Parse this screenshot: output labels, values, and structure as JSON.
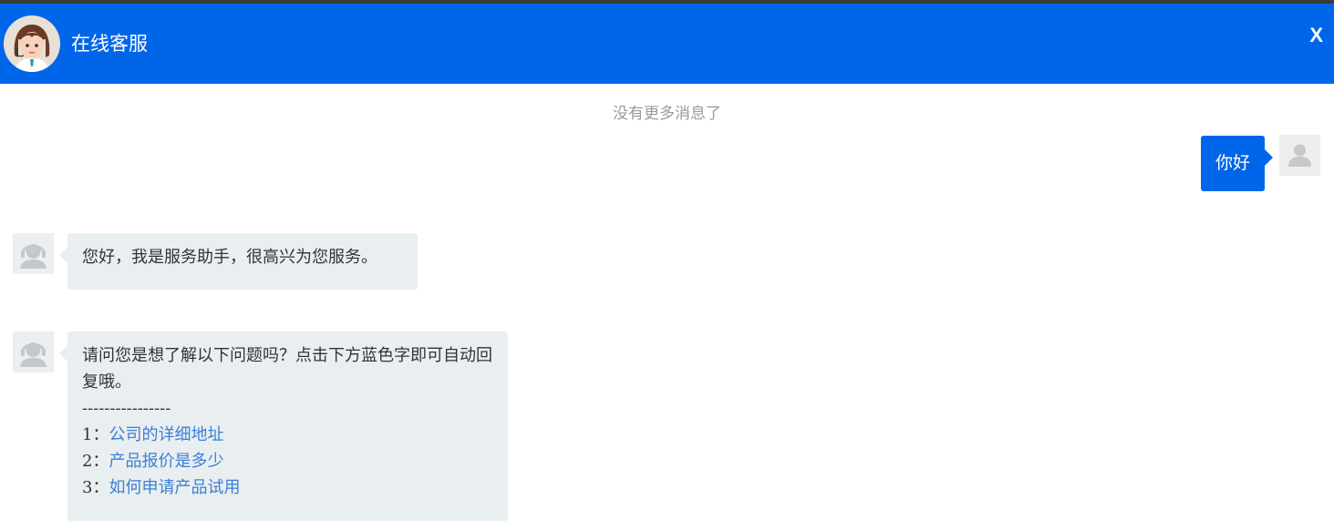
{
  "header": {
    "title": "在线客服",
    "close_label": "X",
    "bg_color": "#0066e9"
  },
  "chat": {
    "no_more_messages": "没有更多消息了",
    "user_message": "你好",
    "bot_greeting": "您好，我是服务助手，很高兴为您服务。",
    "bot_prompt": "请问您是想了解以下问题吗？点击下方蓝色字即可自动回复哦。",
    "divider": "----------------",
    "options": [
      {
        "num": "1：",
        "text": "公司的详细地址"
      },
      {
        "num": "2：",
        "text": "产品报价是多少"
      },
      {
        "num": "3：",
        "text": "如何申请产品试用"
      }
    ],
    "link_color": "#3b7fd8"
  }
}
